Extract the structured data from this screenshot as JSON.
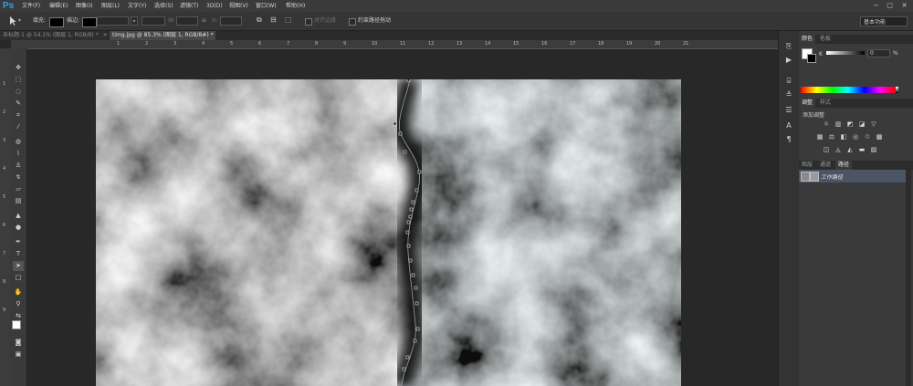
{
  "app": {
    "logo": "Ps"
  },
  "menu": [
    "文件(F)",
    "编辑(E)",
    "图像(I)",
    "图层(L)",
    "文字(Y)",
    "选择(S)",
    "滤镜(T)",
    "3D(D)",
    "视图(V)",
    "窗口(W)",
    "帮助(H)"
  ],
  "window_controls": {
    "minimize": "−",
    "maximize": "□",
    "close": "✕"
  },
  "options_bar": {
    "fill_label": "填充:",
    "stroke_label": "描边:",
    "width_label": "W:",
    "height_label": "H:",
    "align_edges_label": "对齐边缘",
    "constrain_path_label": "约束路径拖动",
    "workspace": "基本功能"
  },
  "tabs": [
    {
      "label": "未标题-1 @ 54.1% (图层 1, RGB/8) *",
      "close": "×",
      "active": false
    },
    {
      "label": "timg.jpg @ 85.3% (图层 1, RGB/8#) *",
      "close": "×",
      "active": true
    }
  ],
  "ruler_top": [
    "1",
    "2",
    "3",
    "4",
    "5",
    "6",
    "7",
    "8",
    "9",
    "10",
    "11",
    "12",
    "13",
    "14",
    "15",
    "16",
    "17",
    "18",
    "19",
    "20",
    "21"
  ],
  "ruler_left": [
    "1",
    "2",
    "3",
    "4",
    "5",
    "6",
    "7",
    "8",
    "9"
  ],
  "color_panel": {
    "tabs": [
      "颜色",
      "色板"
    ],
    "channel": "K",
    "value": "0",
    "unit": "%"
  },
  "adjust_panel": {
    "tabs": [
      "调整",
      "样式"
    ],
    "title": "添加调整"
  },
  "layers_panel": {
    "tabs": [
      "图层",
      "通道",
      "路径"
    ],
    "active_tab": "路径",
    "path_name": "工作路径"
  },
  "colors": {
    "accent": "#2fa1e8",
    "panel": "#3a3a3a",
    "selected_row": "#4b5565"
  }
}
